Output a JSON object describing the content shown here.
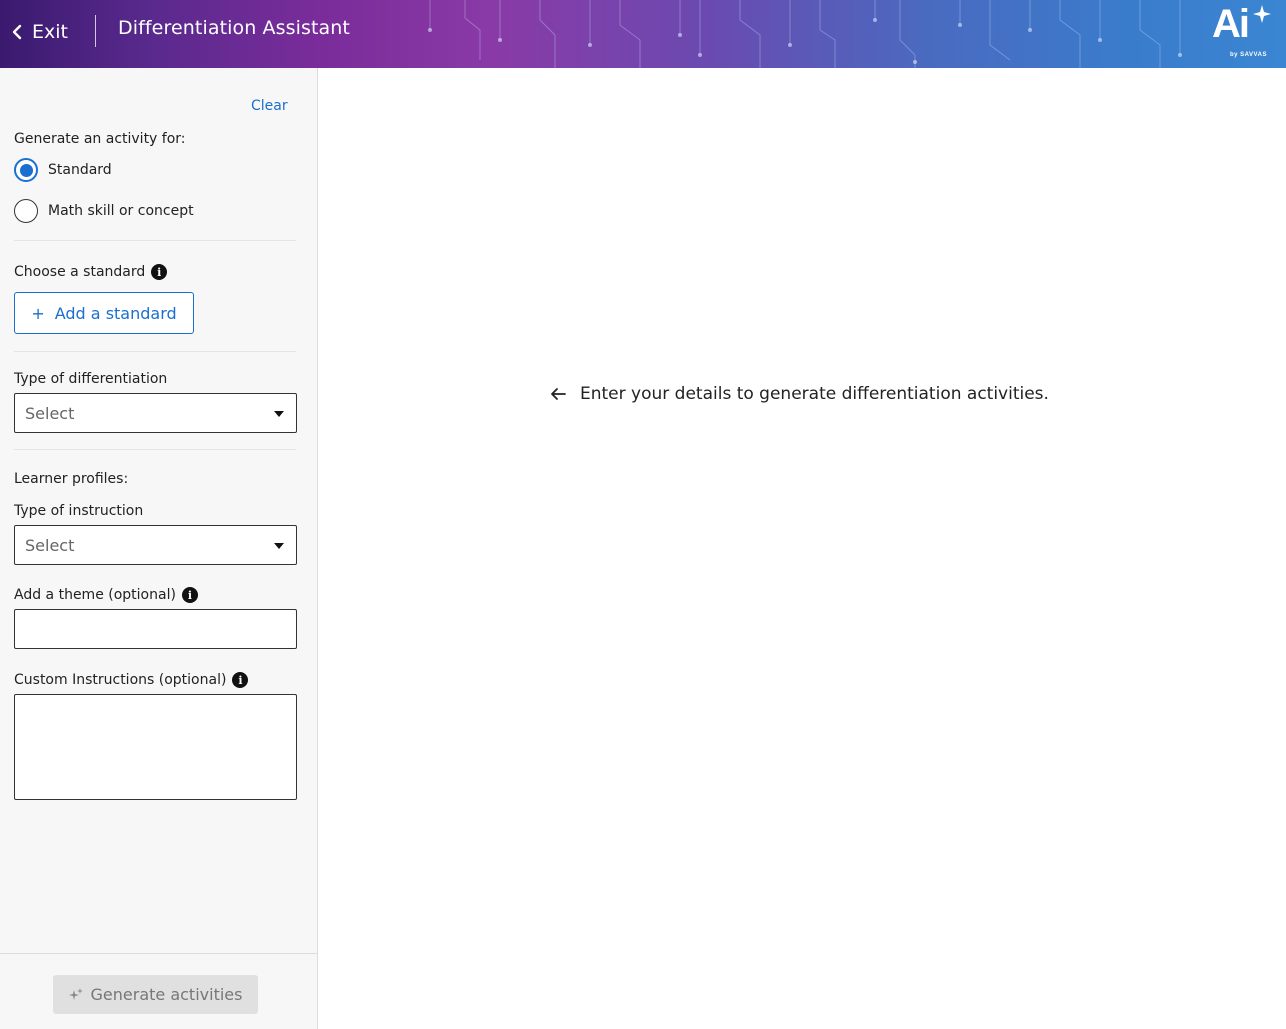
{
  "header": {
    "exit_label": "Exit",
    "title": "Differentiation Assistant",
    "logo_text": "Ai",
    "logo_sub": "by SAVVAS"
  },
  "sidebar": {
    "clear_label": "Clear",
    "generate_for_label": "Generate an activity for:",
    "options": [
      {
        "label": "Standard",
        "checked": true
      },
      {
        "label": "Math skill or concept",
        "checked": false
      }
    ],
    "choose_standard_label": "Choose a standard",
    "add_standard_label": "Add a standard",
    "type_of_differentiation_label": "Type of differentiation",
    "type_of_differentiation_value": "Select",
    "learner_profiles_label": "Learner profiles:",
    "type_of_instruction_label": "Type of instruction",
    "type_of_instruction_value": "Select",
    "theme_label": "Add a theme (optional)",
    "theme_value": "",
    "custom_instructions_label": "Custom Instructions (optional)",
    "custom_instructions_value": "",
    "generate_label": "Generate activities"
  },
  "main": {
    "message": "Enter your details to generate differentiation activities."
  },
  "colors": {
    "accent": "#1a6fd1",
    "disabled_bg": "#e0e0e0"
  }
}
